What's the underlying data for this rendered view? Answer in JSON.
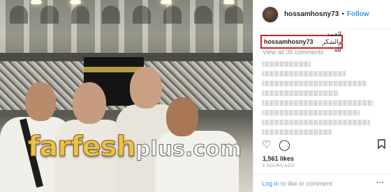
{
  "post": {
    "username": "hossamhosny73",
    "follow_label": "Follow",
    "separator": "•",
    "caption_user": "hossamhosny73",
    "caption_text": "الحمد والشكر لله",
    "view_comments": "View all 35 comments",
    "likes": "1,561 likes",
    "timestamp": "8 HOURS AGO",
    "login_link": "Log in",
    "login_suffix": " to like or comment."
  },
  "watermark": {
    "main": "farfesh",
    "sub": "plus.com"
  },
  "icons": {
    "heart": "heart-icon",
    "comment": "comment-icon",
    "bookmark": "bookmark-icon",
    "more": "more-options-icon"
  },
  "colors": {
    "link": "#3897f0",
    "highlight_box": "#d21f1f",
    "muted": "#999999"
  }
}
